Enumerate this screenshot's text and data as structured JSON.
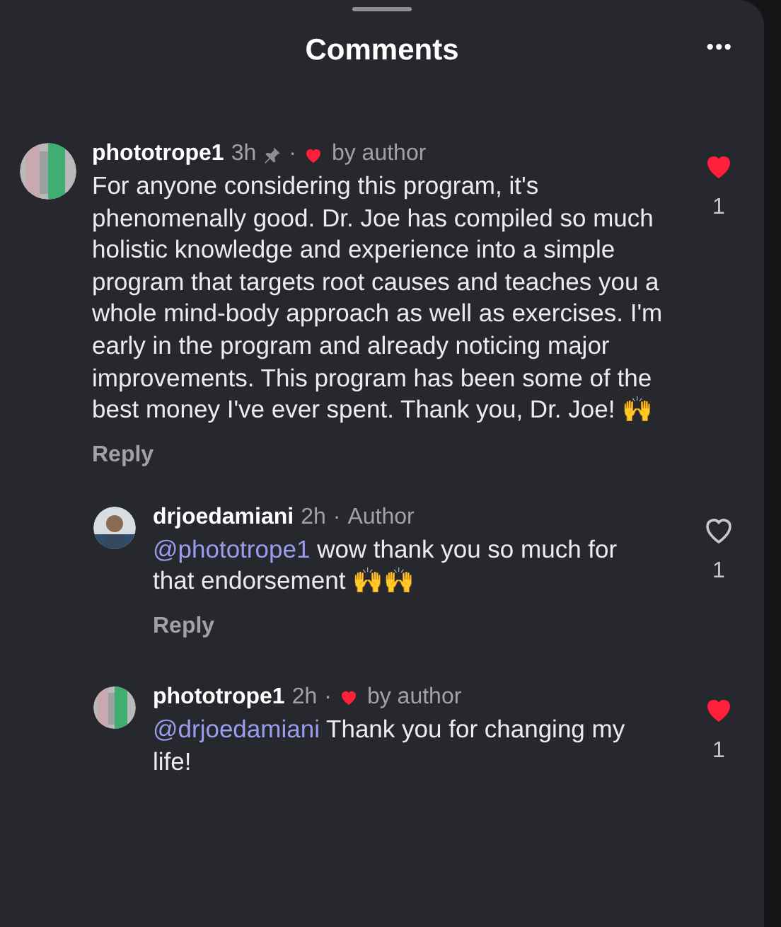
{
  "header": {
    "title": "Comments",
    "menu": "•••"
  },
  "comments": [
    {
      "kind": "comment",
      "username": "phototrope1",
      "time": "3h",
      "pinned": true,
      "separator": "·",
      "liked_by_author": true,
      "liked_by_author_label": "by author",
      "body": "For anyone considering this program, it's phenomenally good. Dr. Joe has compiled so much holistic knowledge and experience into a simple program that targets root causes and teaches you a whole mind-body approach as well as exercises. I'm early in the program and already noticing major improvements. This program has been some of the best money I've ever spent. Thank you, Dr. Joe! 🙌",
      "liked": true,
      "likes": "1",
      "reply": "Reply"
    },
    {
      "kind": "reply",
      "username": "drjoedamiani",
      "time": "2h",
      "separator": "·",
      "badge": "Author",
      "mention": "@phototrope1",
      "body": "wow thank you so much for that endorsement 🙌🙌",
      "liked": false,
      "likes": "1",
      "reply": "Reply"
    },
    {
      "kind": "reply",
      "username": "phototrope1",
      "time": "2h",
      "separator": "·",
      "liked_by_author": true,
      "liked_by_author_label": "by author",
      "mention": "@drjoedamiani",
      "body": "Thank you for changing my life!",
      "liked": true,
      "likes": "1"
    }
  ]
}
